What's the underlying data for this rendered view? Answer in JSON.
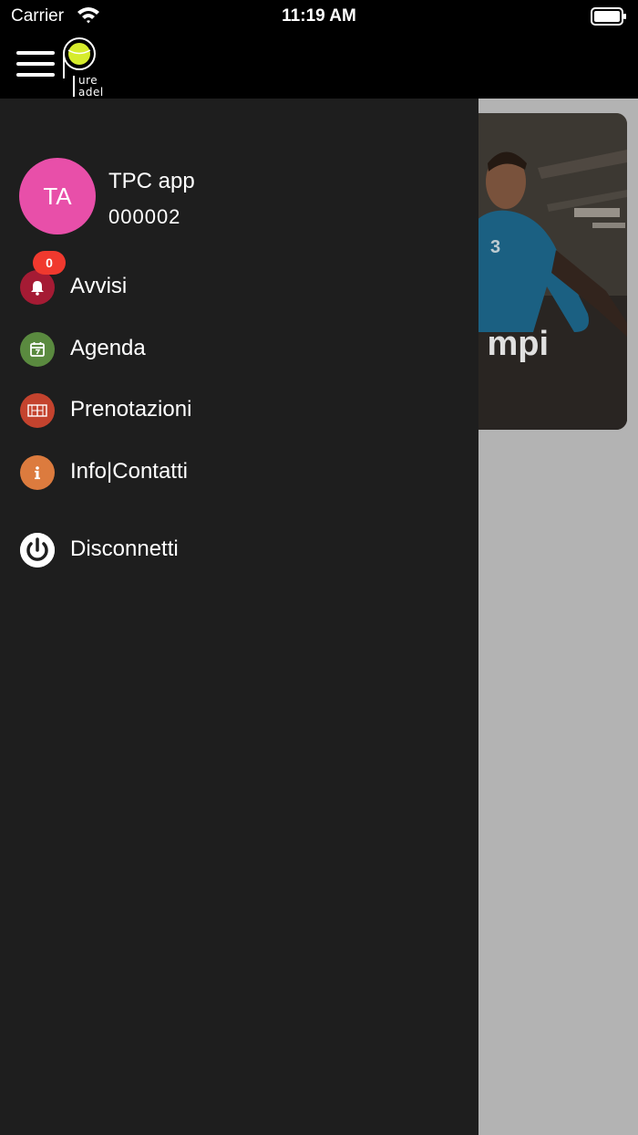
{
  "status_bar": {
    "carrier": "Carrier",
    "time": "11:19 AM"
  },
  "header": {
    "logo_word_top": "ure",
    "logo_word_bottom": "adel"
  },
  "background": {
    "hero_title_partial": "mpi",
    "jersey_number": "3"
  },
  "drawer": {
    "user": {
      "initials": "TA",
      "name": "TPC app",
      "code": "000002",
      "avatar_color": "#e84fa9"
    },
    "items": [
      {
        "label": "Avvisi",
        "icon": "bell-icon",
        "color": "#a51b34",
        "badge": "0"
      },
      {
        "label": "Agenda",
        "icon": "calendar-icon",
        "color": "#5a8a3f"
      },
      {
        "label": "Prenotazioni",
        "icon": "court-icon",
        "color": "#c4432e"
      },
      {
        "label": "Info|Contatti",
        "icon": "info-icon",
        "color": "#dc7b3e"
      },
      {
        "label": "Disconnetti",
        "icon": "power-icon",
        "color": "#ffffff"
      }
    ]
  }
}
